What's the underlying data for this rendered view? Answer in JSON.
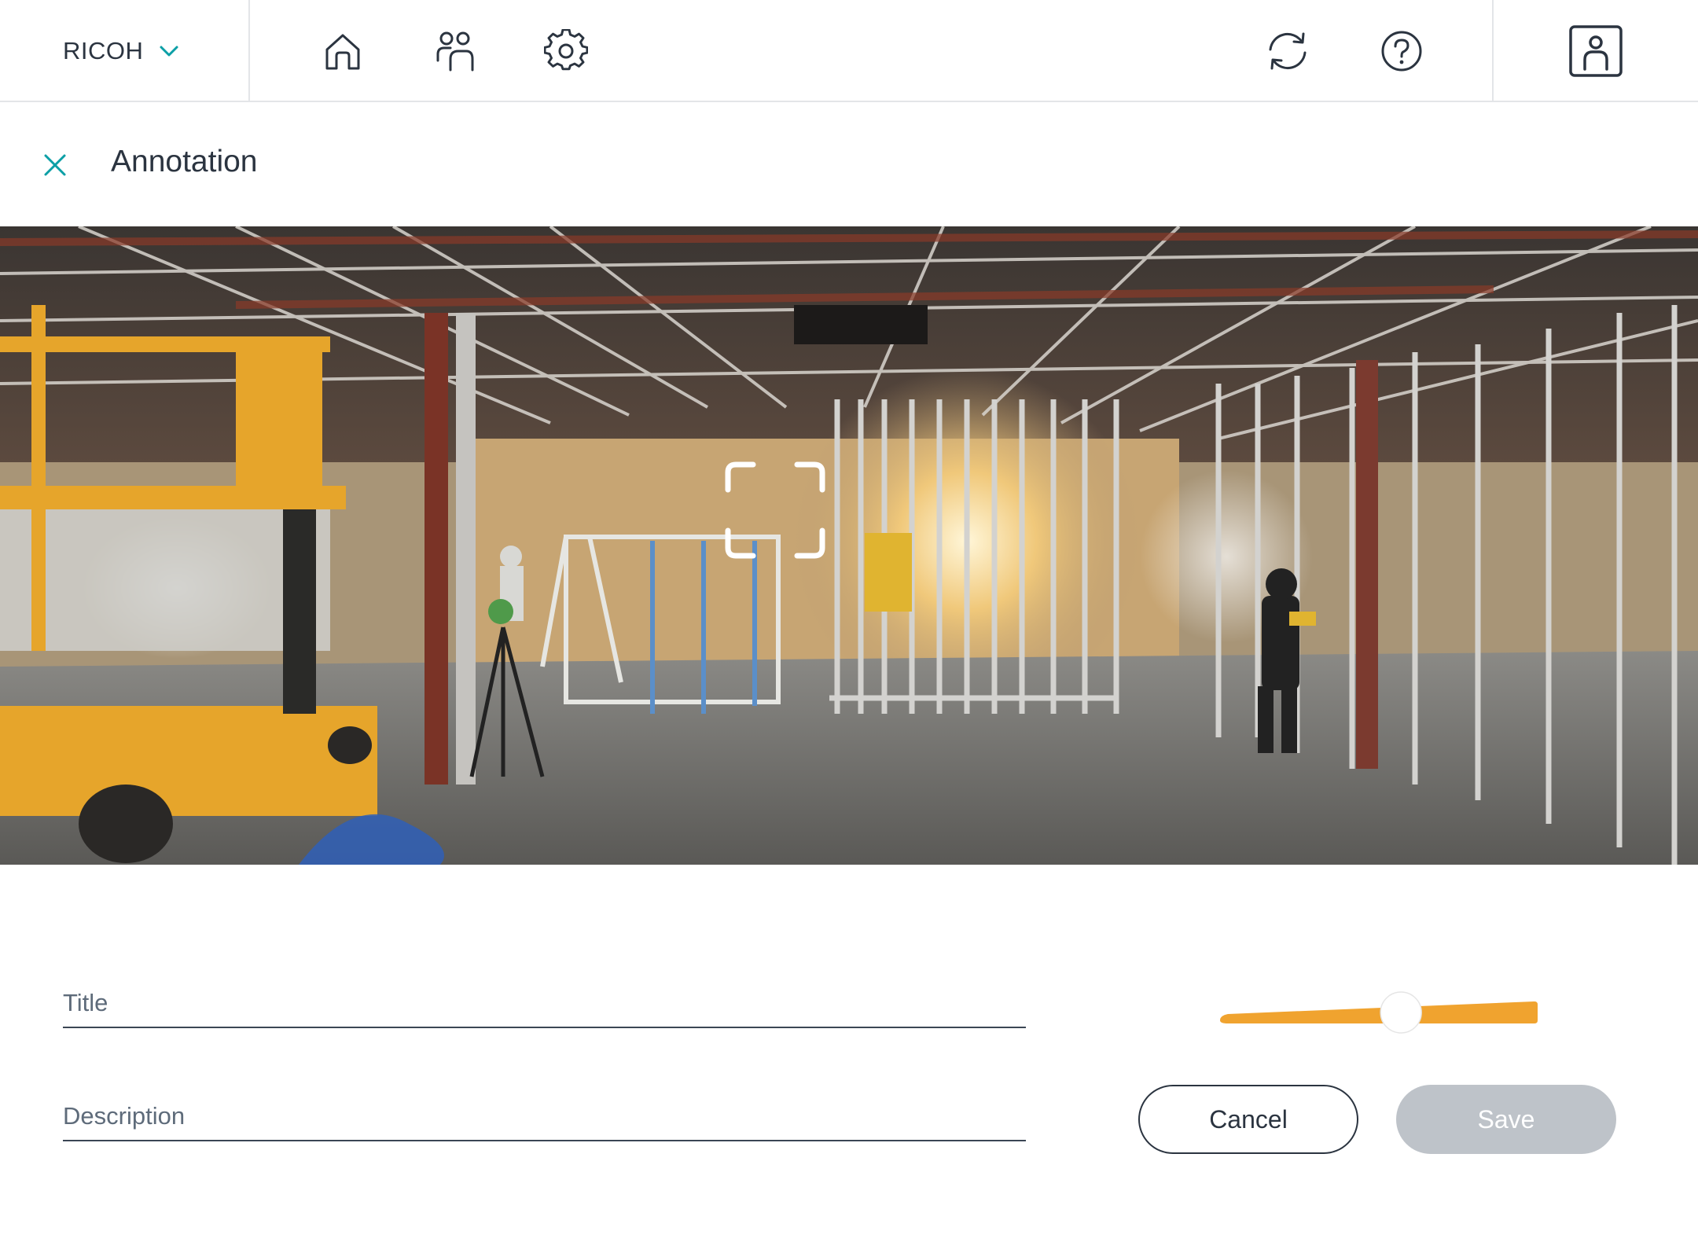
{
  "header": {
    "org_name": "RICOH",
    "nav_icons": [
      "home-icon",
      "users-icon",
      "settings-icon"
    ],
    "right_icons": [
      "sync-icon",
      "help-icon",
      "profile-icon"
    ]
  },
  "panel": {
    "title": "Annotation"
  },
  "form": {
    "title_placeholder": "Title",
    "title_value": "",
    "description_placeholder": "Description",
    "description_value": "",
    "size_slider_value": 0.58,
    "cancel_label": "Cancel",
    "save_label": "Save"
  },
  "colors": {
    "accent": "#0a9fa6",
    "slider": "#f0a32f",
    "text": "#2b3440",
    "disabled": "#bec3c9"
  }
}
